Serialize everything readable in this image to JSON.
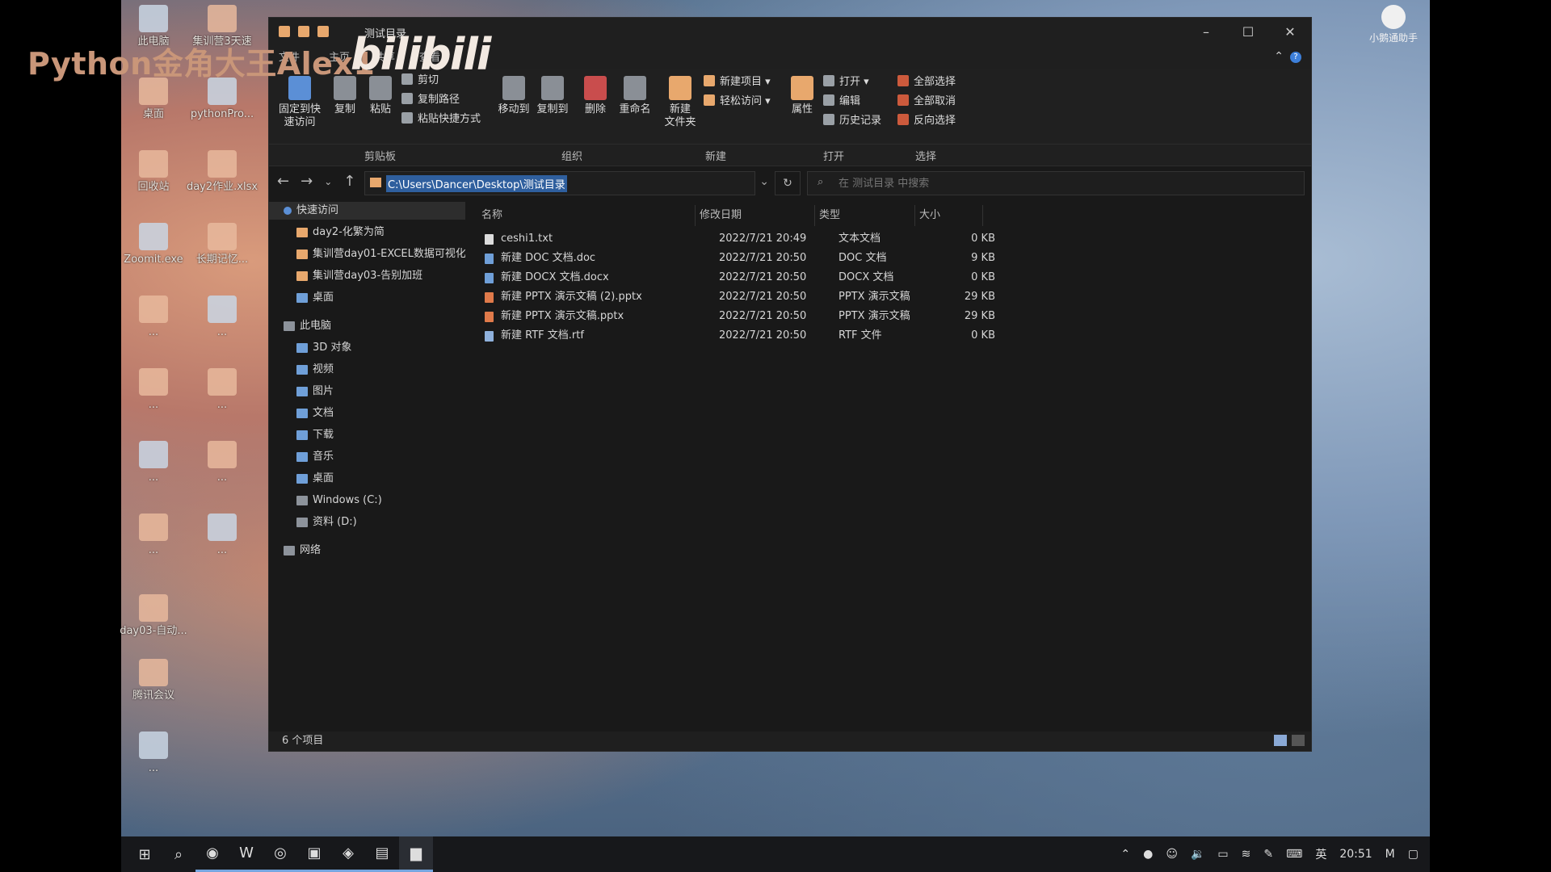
{
  "watermark": {
    "text": "Python金角大王Alex1",
    "logo": "bilibili"
  },
  "desktop_icons": [
    {
      "label": "此电脑"
    },
    {
      "label": "集训营3天速"
    },
    {
      "label": "桌面"
    },
    {
      "label": "pythonPro..."
    },
    {
      "label": "回收站"
    },
    {
      "label": "day2作业.xlsx"
    },
    {
      "label": "Zoomit.exe"
    },
    {
      "label": "长期记忆..."
    },
    {
      "label": "..."
    },
    {
      "label": "..."
    },
    {
      "label": "..."
    },
    {
      "label": "..."
    },
    {
      "label": "..."
    },
    {
      "label": "..."
    },
    {
      "label": "..."
    },
    {
      "label": "..."
    },
    {
      "label": "day03-自动..."
    },
    {
      "label": "腾讯会议"
    },
    {
      "label": "..."
    }
  ],
  "corner_helper": {
    "label": "小鹅通助手"
  },
  "window": {
    "title": "测试目录",
    "controls": {
      "min": "–",
      "max": "☐",
      "close": "✕"
    },
    "tabs": [
      "文件",
      "主页",
      "共享",
      "查看"
    ],
    "ribbon": {
      "pin": "固定到快\n速访问",
      "copy": "复制",
      "paste": "粘贴",
      "cut": "剪切",
      "copy_path": "复制路径",
      "paste_shortcut": "粘贴快捷方式",
      "move_to": "移动到",
      "copy_to": "复制到",
      "delete": "删除",
      "rename": "重命名",
      "new_folder": "新建\n文件夹",
      "new_item": "新建项目 ▾",
      "easy_access": "轻松访问 ▾",
      "properties": "属性",
      "open": "打开 ▾",
      "edit": "编辑",
      "history": "历史记录",
      "select_all": "全部选择",
      "select_none": "全部取消",
      "invert": "反向选择"
    },
    "groups": {
      "clipboard": "剪贴板",
      "organize": "组织",
      "new": "新建",
      "open": "打开",
      "select": "选择"
    },
    "address": {
      "path": "C:\\Users\\Dancer\\Desktop\\测试目录"
    },
    "search": {
      "placeholder": "在 测试目录 中搜索"
    },
    "tree": {
      "quick_access": "快速访问",
      "qa_items": [
        "day2-化繁为简",
        "集训营day01-EXCEL数据可视化",
        "集训营day03-告别加班",
        "桌面"
      ],
      "this_pc": "此电脑",
      "pc_items": [
        "3D 对象",
        "视频",
        "图片",
        "文档",
        "下载",
        "音乐",
        "桌面",
        "Windows (C:)",
        "资料 (D:)"
      ],
      "network": "网络"
    },
    "columns": {
      "name": "名称",
      "date": "修改日期",
      "type": "类型",
      "size": "大小"
    },
    "files": [
      {
        "name": "ceshi1.txt",
        "date": "2022/7/21 20:49",
        "type": "文本文档",
        "size": "0 KB",
        "icon": "txt"
      },
      {
        "name": "新建 DOC 文档.doc",
        "date": "2022/7/21 20:50",
        "type": "DOC 文档",
        "size": "9 KB",
        "icon": "doc"
      },
      {
        "name": "新建 DOCX 文档.docx",
        "date": "2022/7/21 20:50",
        "type": "DOCX 文档",
        "size": "0 KB",
        "icon": "doc"
      },
      {
        "name": "新建 PPTX 演示文稿 (2).pptx",
        "date": "2022/7/21 20:50",
        "type": "PPTX 演示文稿",
        "size": "29 KB",
        "icon": "ppt"
      },
      {
        "name": "新建 PPTX 演示文稿.pptx",
        "date": "2022/7/21 20:50",
        "type": "PPTX 演示文稿",
        "size": "29 KB",
        "icon": "ppt"
      },
      {
        "name": "新建 RTF 文档.rtf",
        "date": "2022/7/21 20:50",
        "type": "RTF 文件",
        "size": "0 KB",
        "icon": "rtf"
      }
    ],
    "status": {
      "count": "6 个项目"
    }
  },
  "taskbar": {
    "lang": "英",
    "time": "20:51"
  }
}
